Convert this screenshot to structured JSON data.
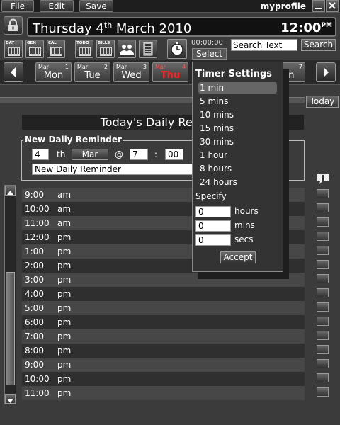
{
  "menu": {
    "file": "File",
    "edit": "Edit",
    "save": "Save"
  },
  "app_title": "myprofile",
  "date_bar": {
    "weekday_day": "Thursday 4",
    "ordinal": "th",
    "month_year": " March 2010",
    "time": "12:00",
    "time_suffix": "PM"
  },
  "toolbar": {
    "day": "DAY",
    "gen": "GEN",
    "cal": "CAL",
    "todo": "TODO",
    "bills": "BILLS",
    "stopwatch_counter": "00:00:00",
    "select_label": "Select",
    "search_value": "Search Text",
    "search_button": "Search"
  },
  "week": {
    "days": [
      {
        "month": "Mar",
        "num": "1",
        "name": "Mon"
      },
      {
        "month": "Mar",
        "num": "2",
        "name": "Tue"
      },
      {
        "month": "Mar",
        "num": "3",
        "name": "Wed"
      },
      {
        "month": "Mar",
        "num": "4",
        "name": "Thu"
      },
      {
        "month": "",
        "num": "7",
        "name": "un"
      }
    ]
  },
  "today_button": "Today",
  "heading": "Today's Daily Rer",
  "new_reminder": {
    "legend": "New Daily Reminder",
    "day_value": "4",
    "day_suffix": "th",
    "month_value": "Mar",
    "at": "@",
    "hour_value": "7",
    "colon": ":",
    "minute_value": "00",
    "text_value": "New Daily Reminder"
  },
  "schedule": [
    {
      "time": "9:00",
      "ampm": "am"
    },
    {
      "time": "10:00",
      "ampm": "am"
    },
    {
      "time": "11:00",
      "ampm": "am"
    },
    {
      "time": "12:00",
      "ampm": "pm"
    },
    {
      "time": "1:00",
      "ampm": "pm"
    },
    {
      "time": "2:00",
      "ampm": "pm"
    },
    {
      "time": "3:00",
      "ampm": "pm"
    },
    {
      "time": "4:00",
      "ampm": "pm"
    },
    {
      "time": "5:00",
      "ampm": "pm"
    },
    {
      "time": "6:00",
      "ampm": "pm"
    },
    {
      "time": "7:00",
      "ampm": "pm"
    },
    {
      "time": "8:00",
      "ampm": "pm"
    },
    {
      "time": "9:00",
      "ampm": "pm"
    },
    {
      "time": "10:00",
      "ampm": "pm"
    },
    {
      "time": "11:00",
      "ampm": "pm"
    }
  ],
  "timer": {
    "title": "Timer Settings",
    "options": [
      "1 min",
      "5 mins",
      "10 mins",
      "15 mins",
      "30 mins",
      "1 hour",
      "8 hours",
      "24 hours"
    ],
    "selected": "1 min",
    "specify": "Specify",
    "hours_value": "0",
    "hours_label": "hours",
    "mins_value": "0",
    "mins_label": "mins",
    "secs_value": "0",
    "secs_label": "secs",
    "accept": "Accept"
  },
  "colors": {
    "today_red": "#ff2222",
    "background": "#3b3b3b",
    "row_light": "#474747",
    "row_dark": "#2f2f2f"
  }
}
